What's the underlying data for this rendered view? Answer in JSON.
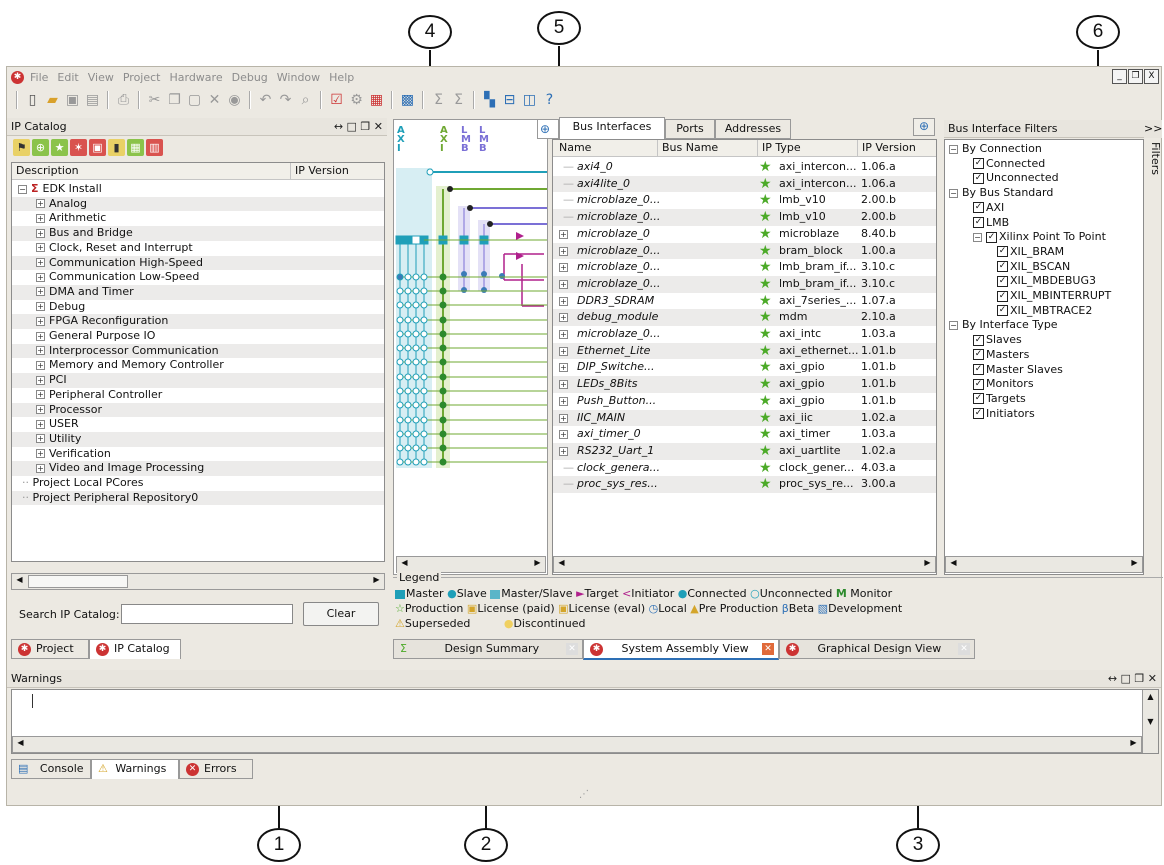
{
  "callouts": [
    "1",
    "2",
    "3",
    "4",
    "5",
    "6"
  ],
  "menu": [
    "File",
    "Edit",
    "View",
    "Project",
    "Hardware",
    "Debug",
    "Window",
    "Help"
  ],
  "window_controls": [
    "_",
    "❐",
    "X"
  ],
  "ip_catalog": {
    "title": "IP Catalog",
    "panel_controls": "↔ □ ❐ ✕",
    "col_description": "Description",
    "col_version": "IP Version",
    "root": "EDK Install",
    "categories": [
      "Analog",
      "Arithmetic",
      "Bus and Bridge",
      "Clock, Reset and Interrupt",
      "Communication High-Speed",
      "Communication Low-Speed",
      "DMA and Timer",
      "Debug",
      "FPGA Reconfiguration",
      "General Purpose IO",
      "Interprocessor Communication",
      "Memory and Memory Controller",
      "PCI",
      "Peripheral Controller",
      "Processor",
      "USER",
      "Utility",
      "Verification",
      "Video and Image Processing"
    ],
    "local": [
      "Project Local PCores",
      "Project Peripheral Repository0"
    ],
    "search_label": "Search IP Catalog:",
    "search_value": "",
    "clear_label": "Clear",
    "tabs": [
      "Project",
      "IP Catalog"
    ]
  },
  "bus_view": {
    "column_labels": [
      [
        "A",
        "X",
        "I"
      ],
      [
        "A",
        "X",
        "I"
      ],
      [
        "L",
        "M",
        "B"
      ],
      [
        "L",
        "M",
        "B"
      ]
    ]
  },
  "assembly": {
    "tabs": [
      "Bus Interfaces",
      "Ports",
      "Addresses"
    ],
    "columns": [
      "Name",
      "Bus Name",
      "IP Type",
      "IP Version"
    ],
    "rows": [
      {
        "name": "axi4_0",
        "type": "axi_intercon...",
        "ver": "1.06.a",
        "exp": false
      },
      {
        "name": "axi4lite_0",
        "type": "axi_intercon...",
        "ver": "1.06.a",
        "exp": false
      },
      {
        "name": "microblaze_0...",
        "type": "lmb_v10",
        "ver": "2.00.b",
        "exp": false
      },
      {
        "name": "microblaze_0...",
        "type": "lmb_v10",
        "ver": "2.00.b",
        "exp": false
      },
      {
        "name": "microblaze_0",
        "type": "microblaze",
        "ver": "8.40.b",
        "exp": true
      },
      {
        "name": "microblaze_0...",
        "type": "bram_block",
        "ver": "1.00.a",
        "exp": true
      },
      {
        "name": "microblaze_0...",
        "type": "lmb_bram_if...",
        "ver": "3.10.c",
        "exp": true
      },
      {
        "name": "microblaze_0...",
        "type": "lmb_bram_if...",
        "ver": "3.10.c",
        "exp": true
      },
      {
        "name": "DDR3_SDRAM",
        "type": "axi_7series_...",
        "ver": "1.07.a",
        "exp": true
      },
      {
        "name": "debug_module",
        "type": "mdm",
        "ver": "2.10.a",
        "exp": true
      },
      {
        "name": "microblaze_0...",
        "type": "axi_intc",
        "ver": "1.03.a",
        "exp": true
      },
      {
        "name": "Ethernet_Lite",
        "type": "axi_ethernet...",
        "ver": "1.01.b",
        "exp": true
      },
      {
        "name": "DIP_Switche...",
        "type": "axi_gpio",
        "ver": "1.01.b",
        "exp": true
      },
      {
        "name": "LEDs_8Bits",
        "type": "axi_gpio",
        "ver": "1.01.b",
        "exp": true
      },
      {
        "name": "Push_Button...",
        "type": "axi_gpio",
        "ver": "1.01.b",
        "exp": true
      },
      {
        "name": "IIC_MAIN",
        "type": "axi_iic",
        "ver": "1.02.a",
        "exp": true
      },
      {
        "name": "axi_timer_0",
        "type": "axi_timer",
        "ver": "1.03.a",
        "exp": true
      },
      {
        "name": "RS232_Uart_1",
        "type": "axi_uartlite",
        "ver": "1.02.a",
        "exp": true
      },
      {
        "name": "clock_genera...",
        "type": "clock_gener...",
        "ver": "4.03.a",
        "exp": false
      },
      {
        "name": "proc_sys_res...",
        "type": "proc_sys_re...",
        "ver": "3.00.a",
        "exp": false
      }
    ]
  },
  "filters": {
    "title": "Bus Interface Filters",
    "collapse": ">>",
    "side_label": "Filters",
    "items": [
      {
        "label": "By Connection",
        "lvl": 0,
        "exp": true,
        "cb": false
      },
      {
        "label": "Connected",
        "lvl": 2,
        "exp": false,
        "cb": true
      },
      {
        "label": "Unconnected",
        "lvl": 2,
        "exp": false,
        "cb": true
      },
      {
        "label": "By Bus Standard",
        "lvl": 0,
        "exp": true,
        "cb": false
      },
      {
        "label": "AXI",
        "lvl": 2,
        "exp": false,
        "cb": true
      },
      {
        "label": "LMB",
        "lvl": 2,
        "exp": false,
        "cb": true
      },
      {
        "label": "Xilinx Point To Point",
        "lvl": 2,
        "exp": true,
        "cb": true
      },
      {
        "label": "XIL_BRAM",
        "lvl": 4,
        "exp": false,
        "cb": true
      },
      {
        "label": "XIL_BSCAN",
        "lvl": 4,
        "exp": false,
        "cb": true
      },
      {
        "label": "XIL_MBDEBUG3",
        "lvl": 4,
        "exp": false,
        "cb": true
      },
      {
        "label": "XIL_MBINTERRUPT",
        "lvl": 4,
        "exp": false,
        "cb": true
      },
      {
        "label": "XIL_MBTRACE2",
        "lvl": 4,
        "exp": false,
        "cb": true
      },
      {
        "label": "By Interface Type",
        "lvl": 0,
        "exp": true,
        "cb": false
      },
      {
        "label": "Slaves",
        "lvl": 2,
        "exp": false,
        "cb": true
      },
      {
        "label": "Masters",
        "lvl": 2,
        "exp": false,
        "cb": true
      },
      {
        "label": "Master Slaves",
        "lvl": 2,
        "exp": false,
        "cb": true
      },
      {
        "label": "Monitors",
        "lvl": 2,
        "exp": false,
        "cb": true
      },
      {
        "label": "Targets",
        "lvl": 2,
        "exp": false,
        "cb": true
      },
      {
        "label": "Initiators",
        "lvl": 2,
        "exp": false,
        "cb": true
      }
    ]
  },
  "legend": {
    "title": "Legend",
    "master": "Master",
    "slave": "Slave",
    "master_slave": "Master/Slave",
    "target": "Target",
    "initiator": "Initiator",
    "connected": "Connected",
    "unconnected": "Unconnected",
    "monitor": "Monitor",
    "production": "Production",
    "license_paid": "License (paid)",
    "license_eval": "License (eval)",
    "local": "Local",
    "pre_production": "Pre Production",
    "beta": "Beta",
    "development": "Development",
    "superseded": "Superseded",
    "discontinued": "Discontinued"
  },
  "views": [
    "Design Summary",
    "System Assembly View",
    "Graphical Design View"
  ],
  "warnings": {
    "title": "Warnings",
    "panel_controls": "↔ □ ❐ ✕",
    "tabs": [
      "Console",
      "Warnings",
      "Errors"
    ]
  },
  "colors": {
    "bg": "#ece9e2",
    "star": "#4caa28",
    "axi": "#1f9fb8",
    "lmb": "#6fa832",
    "target": "#b0208c",
    "callout": "#111111"
  }
}
